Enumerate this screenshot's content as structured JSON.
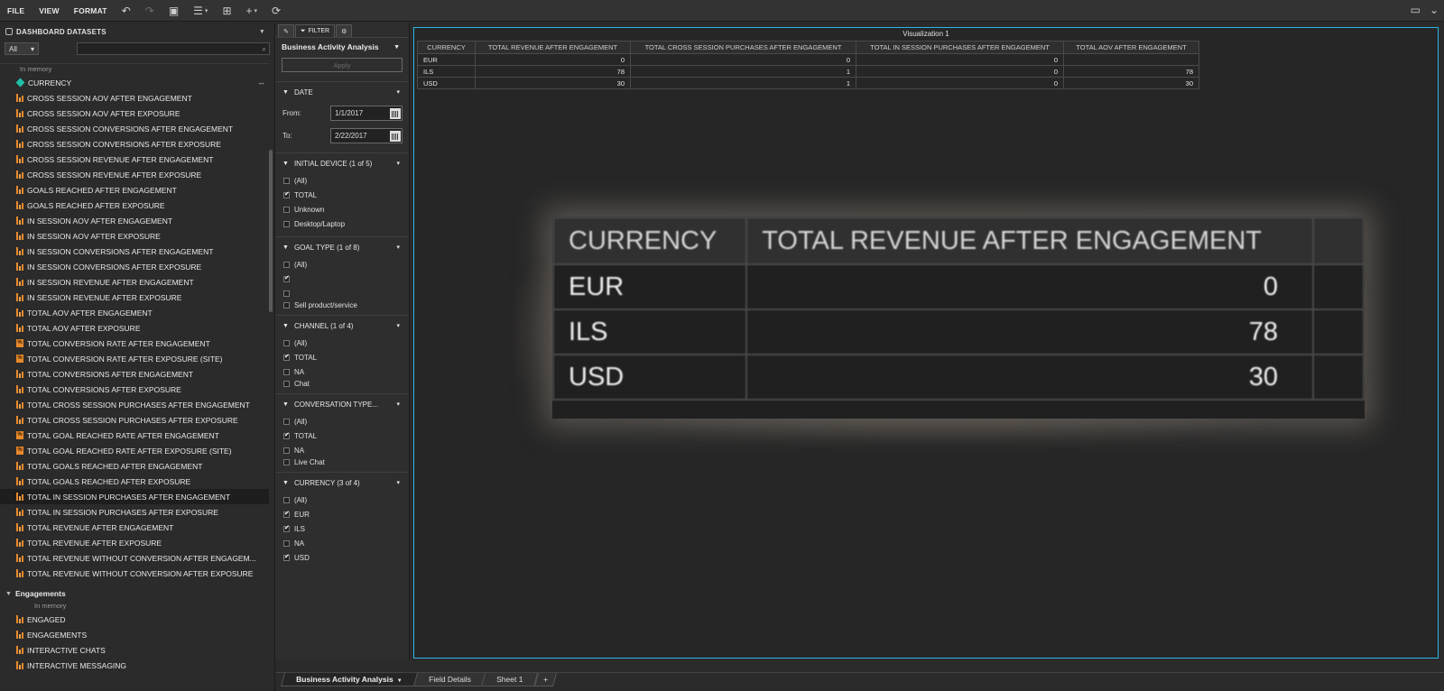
{
  "menu": {
    "file": "FILE",
    "view": "VIEW",
    "format": "FORMAT"
  },
  "left_panel": {
    "title": "DASHBOARD DATASETS",
    "filter_select": "All",
    "sub_label": "In memory",
    "items": [
      {
        "label": "CURRENCY",
        "type": "dimension"
      },
      {
        "label": "CROSS SESSION AOV AFTER ENGAGEMENT",
        "type": "measure"
      },
      {
        "label": "CROSS SESSION AOV AFTER EXPOSURE",
        "type": "measure"
      },
      {
        "label": "CROSS SESSION CONVERSIONS AFTER ENGAGEMENT",
        "type": "measure"
      },
      {
        "label": "CROSS SESSION CONVERSIONS AFTER EXPOSURE",
        "type": "measure"
      },
      {
        "label": "CROSS SESSION REVENUE AFTER ENGAGEMENT",
        "type": "measure"
      },
      {
        "label": "CROSS SESSION REVENUE AFTER EXPOSURE",
        "type": "measure"
      },
      {
        "label": "GOALS REACHED AFTER ENGAGEMENT",
        "type": "measure"
      },
      {
        "label": "GOALS REACHED AFTER EXPOSURE",
        "type": "measure"
      },
      {
        "label": "IN SESSION AOV AFTER ENGAGEMENT",
        "type": "measure"
      },
      {
        "label": "IN SESSION AOV AFTER EXPOSURE",
        "type": "measure"
      },
      {
        "label": "IN SESSION CONVERSIONS AFTER ENGAGEMENT",
        "type": "measure"
      },
      {
        "label": "IN SESSION CONVERSIONS AFTER EXPOSURE",
        "type": "measure"
      },
      {
        "label": "IN SESSION REVENUE AFTER ENGAGEMENT",
        "type": "measure"
      },
      {
        "label": "IN SESSION REVENUE AFTER EXPOSURE",
        "type": "measure"
      },
      {
        "label": "TOTAL AOV AFTER ENGAGEMENT",
        "type": "measure"
      },
      {
        "label": "TOTAL AOV AFTER EXPOSURE",
        "type": "measure"
      },
      {
        "label": "TOTAL CONVERSION RATE AFTER ENGAGEMENT",
        "type": "percent"
      },
      {
        "label": "TOTAL CONVERSION RATE AFTER EXPOSURE (SITE)",
        "type": "percent"
      },
      {
        "label": "TOTAL CONVERSIONS AFTER ENGAGEMENT",
        "type": "measure"
      },
      {
        "label": "TOTAL CONVERSIONS AFTER EXPOSURE",
        "type": "measure"
      },
      {
        "label": "TOTAL CROSS SESSION PURCHASES AFTER ENGAGEMENT",
        "type": "measure"
      },
      {
        "label": "TOTAL CROSS SESSION PURCHASES AFTER EXPOSURE",
        "type": "measure"
      },
      {
        "label": "TOTAL GOAL REACHED RATE AFTER ENGAGEMENT",
        "type": "percent"
      },
      {
        "label": "TOTAL GOAL REACHED RATE AFTER EXPOSURE (SITE)",
        "type": "percent"
      },
      {
        "label": "TOTAL GOALS REACHED AFTER ENGAGEMENT",
        "type": "measure"
      },
      {
        "label": "TOTAL GOALS REACHED AFTER EXPOSURE",
        "type": "measure"
      },
      {
        "label": "TOTAL IN SESSION PURCHASES AFTER ENGAGEMENT",
        "type": "measure",
        "selected": true
      },
      {
        "label": "TOTAL IN SESSION PURCHASES AFTER EXPOSURE",
        "type": "measure"
      },
      {
        "label": "TOTAL REVENUE AFTER ENGAGEMENT",
        "type": "measure"
      },
      {
        "label": "TOTAL REVENUE AFTER EXPOSURE",
        "type": "measure"
      },
      {
        "label": "TOTAL REVENUE WITHOUT CONVERSION AFTER ENGAGEM...",
        "type": "measure"
      },
      {
        "label": "TOTAL REVENUE WITHOUT CONVERSION AFTER EXPOSURE",
        "type": "measure"
      }
    ],
    "group2": {
      "title": "Engagements",
      "sub_label": "In memory",
      "items": [
        "ENGAGED",
        "ENGAGEMENTS",
        "INTERACTIVE CHATS",
        "INTERACTIVE MESSAGING"
      ]
    }
  },
  "filter_panel": {
    "tab_filter": "FILTER",
    "title": "Business Activity Analysis",
    "apply": "Apply",
    "date": {
      "title": "DATE",
      "from_label": "From:",
      "from_value": "1/1/2017",
      "to_label": "To:",
      "to_value": "2/22/2017"
    },
    "groups": [
      {
        "title": "INITIAL DEVICE (1 of 5)",
        "options": [
          {
            "label": "(All)",
            "checked": false
          },
          {
            "label": "TOTAL",
            "checked": true
          },
          {
            "label": "Unknown",
            "checked": false
          },
          {
            "label": "Desktop/Laptop",
            "checked": false
          }
        ]
      },
      {
        "title": "GOAL TYPE (1 of 8)",
        "options": [
          {
            "label": "(All)",
            "checked": false
          },
          {
            "label": "",
            "checked": true
          },
          {
            "label": "",
            "checked": false
          },
          {
            "label": "Sell product/service",
            "checked": false,
            "clipped": true
          }
        ]
      },
      {
        "title": "CHANNEL (1 of 4)",
        "options": [
          {
            "label": "(All)",
            "checked": false
          },
          {
            "label": "TOTAL",
            "checked": true
          },
          {
            "label": "NA",
            "checked": false
          },
          {
            "label": "Chat",
            "checked": false,
            "clipped": true
          }
        ]
      },
      {
        "title": "CONVERSATION TYPE...",
        "options": [
          {
            "label": "(All)",
            "checked": false
          },
          {
            "label": "TOTAL",
            "checked": true
          },
          {
            "label": "NA",
            "checked": false
          },
          {
            "label": "Live Chat",
            "checked": false,
            "clipped": true
          }
        ]
      },
      {
        "title": "CURRENCY (3 of 4)",
        "options": [
          {
            "label": "(All)",
            "checked": false
          },
          {
            "label": "EUR",
            "checked": true
          },
          {
            "label": "ILS",
            "checked": true
          },
          {
            "label": "NA",
            "checked": false
          },
          {
            "label": "USD",
            "checked": true
          }
        ]
      }
    ]
  },
  "visualization": {
    "title": "Visualization 1",
    "columns": [
      "CURRENCY",
      "TOTAL REVENUE AFTER ENGAGEMENT",
      "TOTAL CROSS SESSION PURCHASES AFTER ENGAGEMENT",
      "TOTAL IN SESSION PURCHASES AFTER ENGAGEMENT",
      "TOTAL AOV AFTER ENGAGEMENT"
    ],
    "rows": [
      [
        "EUR",
        "0",
        "0",
        "0",
        ""
      ],
      [
        "ILS",
        "78",
        "1",
        "0",
        "78"
      ],
      [
        "USD",
        "30",
        "1",
        "0",
        "30"
      ]
    ]
  },
  "zoom": {
    "columns": [
      "CURRENCY",
      "TOTAL REVENUE AFTER ENGAGEMENT"
    ],
    "rows": [
      [
        "EUR",
        "0"
      ],
      [
        "ILS",
        "78"
      ],
      [
        "USD",
        "30"
      ]
    ]
  },
  "sheets": [
    "Business Activity Analysis",
    "Field Details",
    "Sheet 1",
    "+"
  ],
  "colors": {
    "accent": "#2ab4e6",
    "measure": "#e8892c",
    "dimension": "#1fbfa6"
  }
}
